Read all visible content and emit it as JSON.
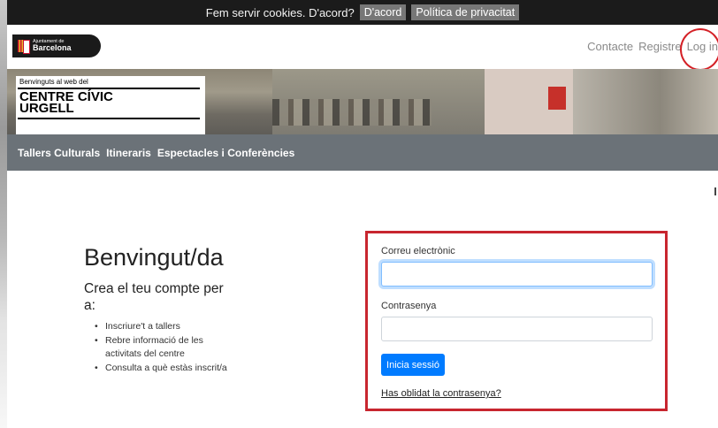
{
  "cookie_bar": {
    "message": "Fem servir cookies. D'acord?",
    "accept_label": "D'acord",
    "privacy_label": "Política de privacitat"
  },
  "header": {
    "logo": {
      "line1": "Ajuntament de",
      "line2": "Barcelona"
    },
    "links": {
      "contact": "Contacte",
      "register": "Registre",
      "login": "Log in"
    }
  },
  "banner": {
    "small_text": "Benvinguts al web del",
    "title_line1": "CENTRE CÍVIC",
    "title_line2": "URGELL"
  },
  "nav": {
    "items": [
      "Tallers Culturals",
      "Itineraris",
      "Espectacles i Conferències"
    ]
  },
  "welcome": {
    "title": "Benvingut/da",
    "subtitle": "Crea el teu compte per a:",
    "items": [
      "Inscriure't a tallers",
      "Rebre informació de les activitats del centre",
      "Consulta a què estàs inscrit/a"
    ]
  },
  "form": {
    "email_label": "Correu electrònic",
    "email_value": "",
    "password_label": "Contrasenya",
    "password_value": "",
    "submit_label": "Inicia sessió",
    "forgot_label": "Has oblidat la contrasenya?"
  },
  "colors": {
    "highlight": "#c8262f",
    "primary_button": "#007bff",
    "nav_bg": "#6b7278"
  }
}
